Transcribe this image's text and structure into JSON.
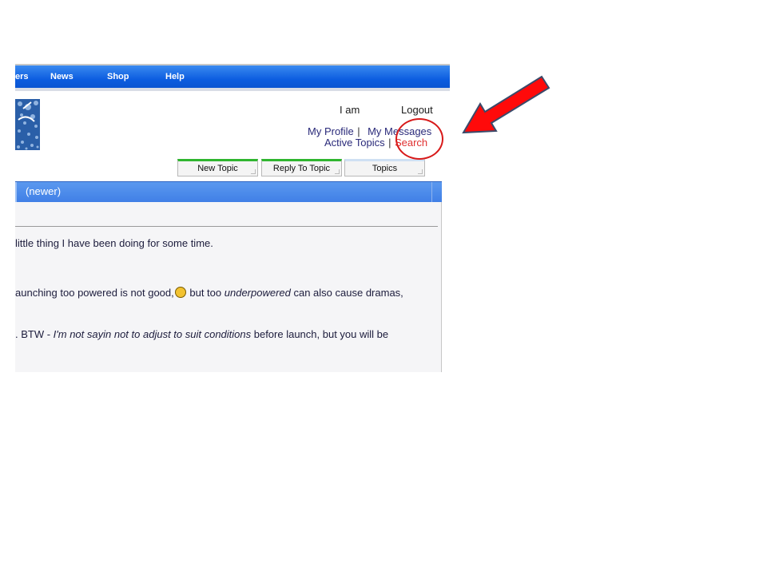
{
  "nav": {
    "items": [
      {
        "label": "ers"
      },
      {
        "label": "News"
      },
      {
        "label": "Shop"
      },
      {
        "label": "Help"
      }
    ]
  },
  "header": {
    "greeting": "I am",
    "logout": "Logout",
    "my_profile": "My Profile",
    "my_messages": "My Messages",
    "active_topics": "Active Topics",
    "search": "Search",
    "sep": "|"
  },
  "tabs": {
    "new_topic": "New Topic",
    "reply": "Reply To Topic",
    "topics": "Topics"
  },
  "post": {
    "newer": "(newer)",
    "line1": "little thing I have been doing for some time.",
    "line2_a": "aunching too powered is not good,",
    "line2_b": " but too ",
    "line2_em": "underpowered",
    "line2_c": " can also cause dramas,",
    "line3_a": ". BTW - ",
    "line3_em": "I'm not sayin not to adjust to suit conditions",
    "line3_b": " before launch, but you will be"
  },
  "colors": {
    "nav_blue": "#0c5de0",
    "search_red": "#e03030",
    "annotation_red": "#d81a1a"
  },
  "icons": [
    "smiley-icon",
    "forum-logo",
    "arrow-annotation",
    "circle-annotation"
  ]
}
